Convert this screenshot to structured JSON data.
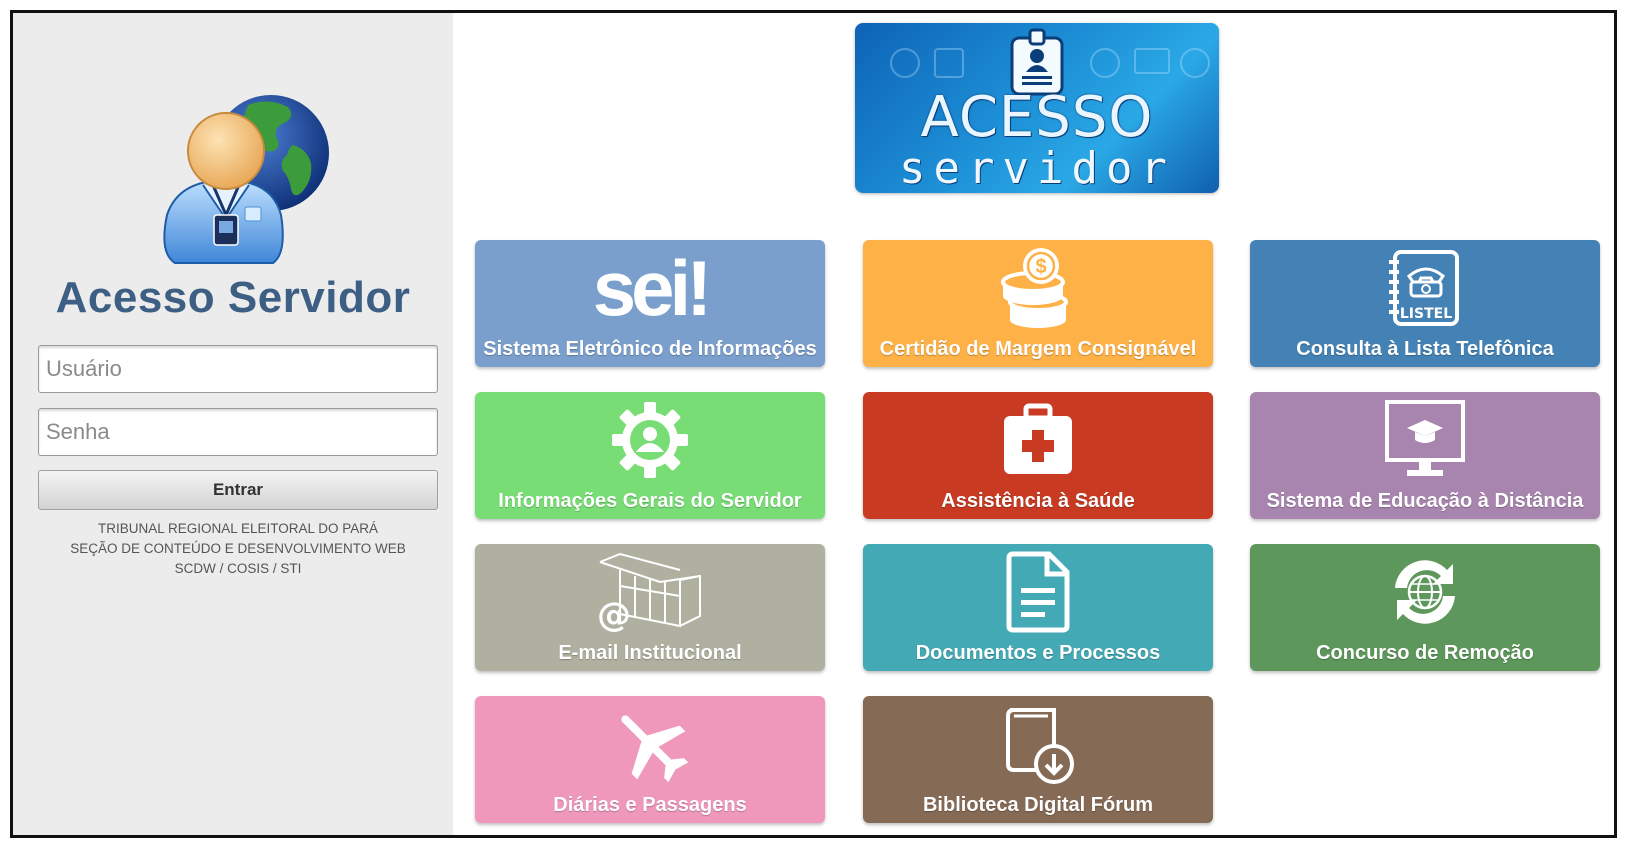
{
  "login": {
    "title": "Acesso Servidor",
    "username_placeholder": "Usuário",
    "password_placeholder": "Senha",
    "submit_label": "Entrar",
    "footer": [
      "TRIBUNAL REGIONAL ELEITORAL DO PARÁ",
      "SEÇÃO DE CONTEÚDO E DESENVOLVIMENTO WEB",
      "SCDW / COSIS / STI"
    ]
  },
  "banner": {
    "line1": "ACESSO",
    "line2": "servidor"
  },
  "tiles": [
    {
      "label": "Sistema Eletrônico de Informações",
      "icon": "sei-logo",
      "color": "#7b9fcc",
      "logo_text": "sei!"
    },
    {
      "label": "Certidão de Margem Consignável",
      "icon": "coins-icon",
      "color": "#fdb147"
    },
    {
      "label": "Consulta à Lista Telefônica",
      "icon": "listel-phonebook-icon",
      "color": "#4482b5",
      "logo_text": "LISTEL"
    },
    {
      "label": "Informações Gerais do Servidor",
      "icon": "user-gear-icon",
      "color": "#79dd76"
    },
    {
      "label": "Assistência à Saúde",
      "icon": "first-aid-kit-icon",
      "color": "#c83a22"
    },
    {
      "label": "Sistema de Educação à Distância",
      "icon": "monitor-graduation-icon",
      "color": "#a885ae"
    },
    {
      "label": "E-mail Institucional",
      "icon": "email-building-icon",
      "color": "#b0b0a1"
    },
    {
      "label": "Documentos e Processos",
      "icon": "document-icon",
      "color": "#43aab5"
    },
    {
      "label": "Concurso de Remoção",
      "icon": "globe-refresh-icon",
      "color": "#5d975b"
    },
    {
      "label": "Diárias e Passagens",
      "icon": "airplane-icon",
      "color": "#ef98bc"
    },
    {
      "label": "Biblioteca Digital Fórum",
      "icon": "book-download-icon",
      "color": "#856a55"
    }
  ]
}
